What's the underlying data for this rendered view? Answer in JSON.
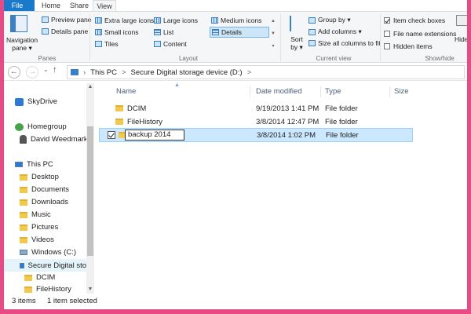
{
  "tabs": {
    "file": "File",
    "home": "Home",
    "share": "Share",
    "view": "View"
  },
  "ribbon": {
    "panes": {
      "label": "Panes",
      "navigation_pane": "Navigation pane ▾",
      "preview_pane": "Preview pane",
      "details_pane": "Details pane"
    },
    "layout": {
      "label": "Layout",
      "extra_large_icons": "Extra large icons",
      "large_icons": "Large icons",
      "medium_icons": "Medium icons",
      "small_icons": "Small icons",
      "list": "List",
      "details": "Details",
      "tiles": "Tiles",
      "content": "Content"
    },
    "current_view": {
      "label": "Current view",
      "sort_by": "Sort by ▾",
      "group_by": "Group by ▾",
      "add_columns": "Add columns ▾",
      "size_all_columns": "Size all columns to fit"
    },
    "show_hide": {
      "label": "Show/hide",
      "item_check_boxes": "Item check boxes",
      "item_check_boxes_checked": true,
      "file_name_extensions": "File name extensions",
      "file_name_extensions_checked": false,
      "hidden_items": "Hidden items",
      "hidden_items_checked": false,
      "hide_selected": "Hide s"
    }
  },
  "address": {
    "segments": [
      "This PC",
      ">",
      "Secure Digital storage device (D:)",
      ">"
    ]
  },
  "nav": {
    "skydrive": "SkyDrive",
    "homegroup": "Homegroup",
    "user": "David Weedmark",
    "this_pc": "This PC",
    "desktop": "Desktop",
    "documents": "Documents",
    "downloads": "Downloads",
    "music": "Music",
    "pictures": "Pictures",
    "videos": "Videos",
    "windows_c": "Windows (C:)",
    "secure_digital": "Secure Digital sto",
    "dcim": "DCIM",
    "filehistory": "FileHistory"
  },
  "columns": {
    "name": "Name",
    "date_modified": "Date modified",
    "type": "Type",
    "size": "Size"
  },
  "files": [
    {
      "name": "DCIM",
      "date": "9/19/2013 1:41 PM",
      "type": "File folder"
    },
    {
      "name": "FileHistory",
      "date": "3/8/2014 12:47 PM",
      "type": "File folder"
    },
    {
      "name": "backup 2014",
      "date": "3/8/2014 1:02 PM",
      "type": "File folder"
    }
  ],
  "status": {
    "items": "3 items",
    "selected": "1 item selected"
  },
  "colors": {
    "accent": "#1979ca",
    "selection": "#cce8ff",
    "frame": "#e84a86"
  }
}
